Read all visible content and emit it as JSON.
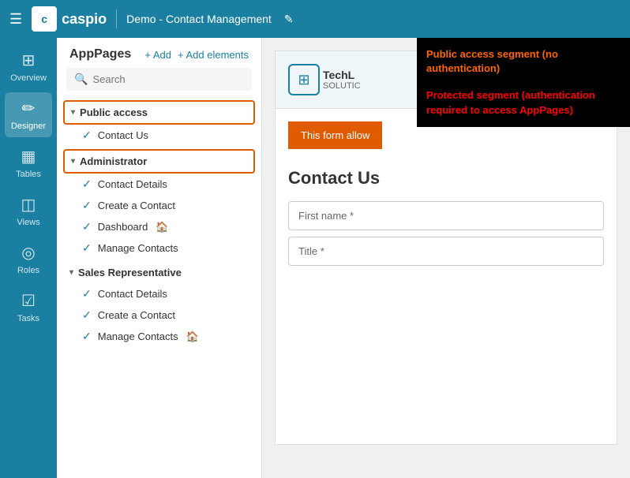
{
  "topNav": {
    "hamburger": "☰",
    "logoText": "caspio",
    "projectName": "Demo - Contact Management",
    "editIcon": "✎"
  },
  "sidebar": {
    "items": [
      {
        "id": "overview",
        "label": "Overview",
        "icon": "⊞",
        "active": false
      },
      {
        "id": "designer",
        "label": "Designer",
        "icon": "✏",
        "active": true
      },
      {
        "id": "tables",
        "label": "Tables",
        "icon": "▦",
        "active": false
      },
      {
        "id": "views",
        "label": "Views",
        "icon": "◫",
        "active": false
      },
      {
        "id": "roles",
        "label": "Roles",
        "icon": "◎",
        "active": false
      },
      {
        "id": "tasks",
        "label": "Tasks",
        "icon": "☑",
        "active": false
      }
    ]
  },
  "appPages": {
    "title": "AppPages",
    "addLabel": "+ Add",
    "addElementsLabel": "+ Add elements",
    "searchPlaceholder": "Search",
    "segments": [
      {
        "id": "public",
        "name": "Public access",
        "outlined": true,
        "pages": [
          {
            "id": "contact-us",
            "name": "Contact Us",
            "active": false,
            "hasHome": false
          }
        ]
      },
      {
        "id": "administrator",
        "name": "Administrator",
        "outlined": true,
        "pages": [
          {
            "id": "contact-details-admin",
            "name": "Contact Details",
            "active": false,
            "hasHome": false
          },
          {
            "id": "create-contact-admin",
            "name": "Create a Contact",
            "active": false,
            "hasHome": false
          },
          {
            "id": "dashboard",
            "name": "Dashboard",
            "active": false,
            "hasHome": true
          },
          {
            "id": "manage-contacts-admin",
            "name": "Manage Contacts",
            "active": false,
            "hasHome": false
          }
        ]
      },
      {
        "id": "sales-rep",
        "name": "Sales Representative",
        "outlined": false,
        "pages": [
          {
            "id": "contact-details-sales",
            "name": "Contact Details",
            "active": false,
            "hasHome": false
          },
          {
            "id": "create-contact-sales",
            "name": "Create a Contact",
            "active": false,
            "hasHome": false
          },
          {
            "id": "manage-contacts-sales",
            "name": "Manage Contacts",
            "active": false,
            "hasHome": true
          }
        ]
      }
    ]
  },
  "preview": {
    "techName": "TechL",
    "techSub": "SOLUTIC",
    "techLogoIcon": "⊞",
    "orangeBtnText": "This form allow",
    "sectionTitle": "Contact Us",
    "firstNameLabel": "First name *",
    "titleLabel": "Title *"
  },
  "annotations": {
    "first": "Public access segment (no authentication)",
    "second": "Protected segment (authentication required to access AppPages)"
  }
}
